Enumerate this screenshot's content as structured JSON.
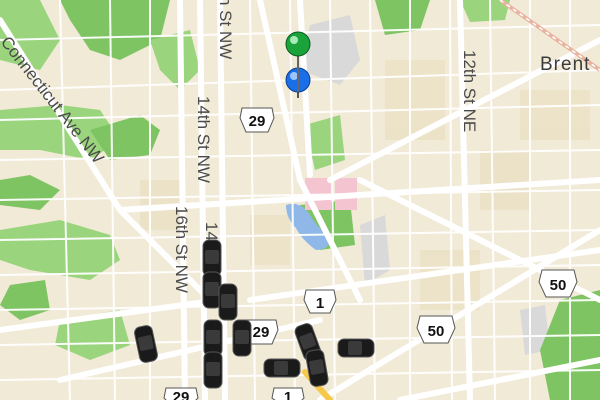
{
  "map": {
    "colors": {
      "land": "#f1ead7",
      "park": "#9ad47c",
      "park_dark": "#7ec463",
      "water": "#8fb8e8",
      "road_major": "#ffffff",
      "road_minor": "#ffffff",
      "building": "#e8dcbc",
      "special": "#f4c4d0",
      "gray_area": "#d9d9d9"
    },
    "labels": {
      "connecticut": "Connecticut Ave NW",
      "st_top": "h St NW",
      "fourteenth_a": "14th St NW",
      "fourteenth_b": "14",
      "sixteenth": "16th St NW",
      "twelfth": "12th St NE",
      "place": "Brent"
    },
    "shields": {
      "s29_top": "29",
      "s29_bottom": "29",
      "s1_mid": "1",
      "s1_bottom": "1",
      "s50_right": "50",
      "s50_mid": "50",
      "s29_bl": "29"
    },
    "pins": [
      {
        "name": "green-pin",
        "color": "#1aa33a"
      },
      {
        "name": "user-location",
        "color": "#1a6fe8"
      }
    ],
    "vehicles_icon": "car-icon"
  }
}
